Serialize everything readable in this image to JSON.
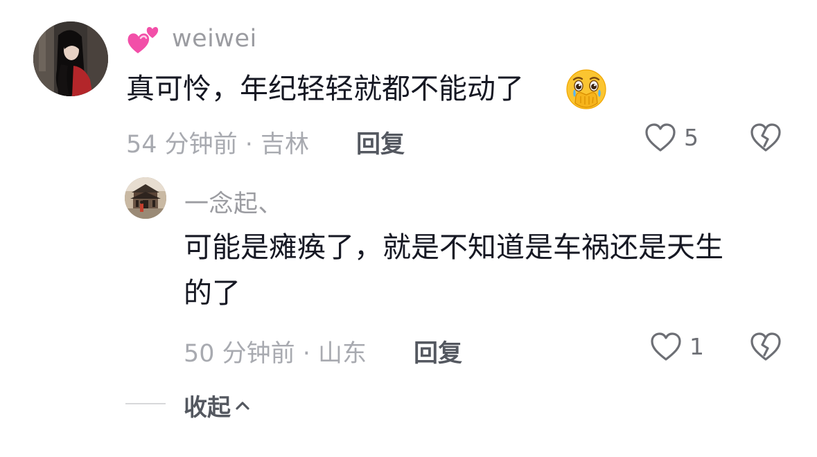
{
  "comment": {
    "username": "weiwei",
    "text": "真可怜，年纪轻轻就都不能动了",
    "meta": "54 分钟前 · 吉林",
    "reply_label": "回复",
    "like_count": "5",
    "badge_icon": "two-hearts-icon",
    "emoji_icon": "face-holding-back-tears-icon"
  },
  "reply": {
    "username": "一念起、",
    "text_line1": "可能是瘫痪了，就是不知道是车祸还是天生",
    "text_line2": "的了",
    "meta": "50 分钟前 · 山东",
    "reply_label": "回复",
    "like_count": "1"
  },
  "collapse": {
    "label": "收起"
  },
  "colors": {
    "primary_text": "#161823",
    "secondary_text": "#a8aab0",
    "username": "#9b9ca1",
    "action_text": "#545860",
    "badge_pink": "#f24fa8"
  }
}
